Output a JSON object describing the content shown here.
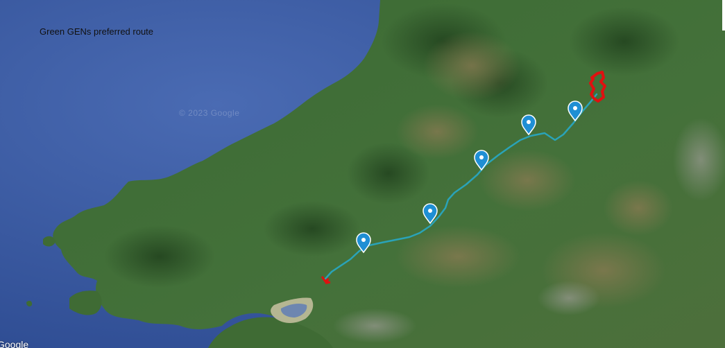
{
  "map": {
    "title": "Green GENs preferred route",
    "watermark": "© 2023 Google",
    "logo": "Google",
    "colors": {
      "sea": "#3f5fa6",
      "land": "#3f6b34",
      "route": "#2aa3b8",
      "endpoint": "#e01010",
      "marker": "#1f8fd4"
    },
    "marker_icon": "map-pin-icon",
    "marker_count": 5
  }
}
